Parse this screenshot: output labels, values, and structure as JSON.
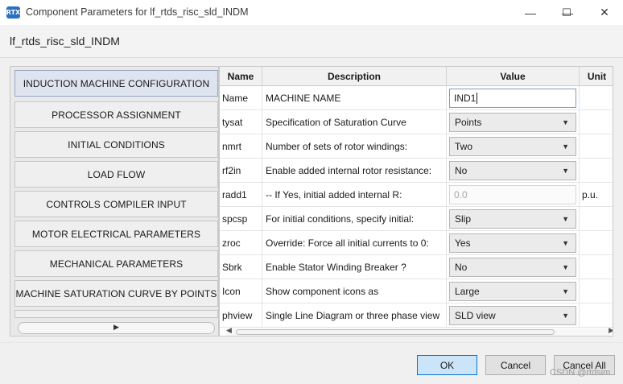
{
  "window": {
    "icon_text": "RTX",
    "title": "Component Parameters for lf_rtds_risc_sld_INDM",
    "minimize": "—",
    "maximize": "☐",
    "close": "✕"
  },
  "component_name": "lf_rtds_risc_sld_INDM",
  "nav": {
    "items": [
      {
        "label": "INDUCTION MACHINE CONFIGURATION",
        "active": true
      },
      {
        "label": "PROCESSOR ASSIGNMENT"
      },
      {
        "label": "INITIAL CONDITIONS"
      },
      {
        "label": "LOAD FLOW"
      },
      {
        "label": "CONTROLS COMPILER INPUT"
      },
      {
        "label": "MOTOR ELECTRICAL PARAMETERS"
      },
      {
        "label": "MECHANICAL PARAMETERS"
      },
      {
        "label": "MACHINE SATURATION CURVE BY POINTS"
      }
    ],
    "scroll_arrow": "▶"
  },
  "table": {
    "headers": {
      "name": "Name",
      "description": "Description",
      "value": "Value",
      "unit": "Unit"
    },
    "rows": [
      {
        "name": "Name",
        "description": "MACHINE NAME",
        "value": "IND1",
        "unit": "",
        "kind": "text"
      },
      {
        "name": "tysat",
        "description": "Specification of Saturation Curve",
        "value": "Points",
        "unit": "",
        "kind": "combo"
      },
      {
        "name": "nmrt",
        "description": "Number of sets of rotor windings:",
        "value": "Two",
        "unit": "",
        "kind": "combo"
      },
      {
        "name": "rf2in",
        "description": "Enable added internal rotor resistance:",
        "value": "No",
        "unit": "",
        "kind": "combo"
      },
      {
        "name": "radd1",
        "description": " -- If Yes, initial added internal R:",
        "value": "0.0",
        "unit": "p.u.",
        "kind": "disabled"
      },
      {
        "name": "spcsp",
        "description": "For initial conditions, specify initial:",
        "value": "Slip",
        "unit": "",
        "kind": "combo"
      },
      {
        "name": "zroc",
        "description": "Override: Force all initial currents to 0:",
        "value": "Yes",
        "unit": "",
        "kind": "combo"
      },
      {
        "name": "Sbrk",
        "description": "Enable Stator Winding Breaker ?",
        "value": "No",
        "unit": "",
        "kind": "combo"
      },
      {
        "name": "Icon",
        "description": "Show component icons as",
        "value": "Large",
        "unit": "",
        "kind": "combo"
      },
      {
        "name": "phview",
        "description": "Single Line Diagram or three phase view",
        "value": "SLD view",
        "unit": "",
        "kind": "combo"
      }
    ],
    "dropdown_arrow": "▼",
    "scroll_left": "◀",
    "scroll_right": "▶"
  },
  "buttons": {
    "ok": "OK",
    "cancel": "Cancel",
    "cancel_all": "Cancel All"
  },
  "watermark": "CSDN @rtdsim"
}
